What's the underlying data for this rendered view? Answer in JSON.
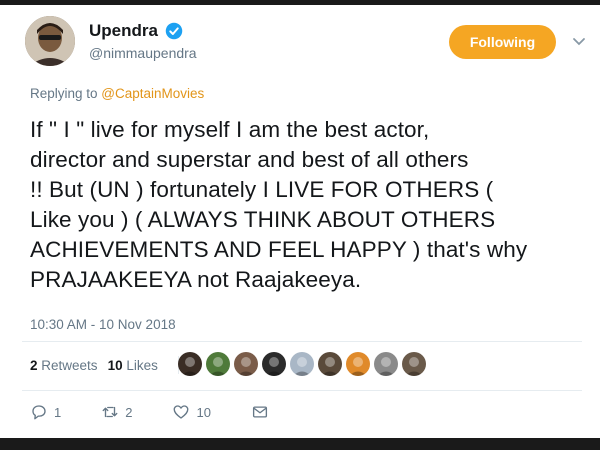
{
  "author": {
    "name": "Upendra",
    "handle": "@nimmaupendra",
    "avatar_icon": "profile-photo"
  },
  "follow_button": {
    "label": "Following",
    "color": "#f5a623"
  },
  "reply": {
    "prefix": "Replying to ",
    "mention": "@CaptainMovies",
    "mention_color": "#e29519"
  },
  "tweet": {
    "text": "If  \" I \"  live for myself I am the best actor,\ndirector and superstar and best of all others\n!!   But (UN ) fortunately I LIVE FOR OTHERS (\nLike you )  ( ALWAYS THINK ABOUT OTHERS\nACHIEVEMENTS AND FEEL HAPPY ) that's why\nPRAJAAKEEYA not Raajakeeya.",
    "timestamp": "10:30 AM - 10 Nov 2018"
  },
  "stats": {
    "retweets_count": "2",
    "retweets_label": "Retweets",
    "likes_count": "10",
    "likes_label": "Likes",
    "liker_avatars": [
      "#3a2d25",
      "#4f7a3a",
      "#7a5c49",
      "#2b2b2b",
      "#a9b7c6",
      "#5a4a3a",
      "#e08a2a",
      "#8a8a8a",
      "#6a5a4a"
    ]
  },
  "actions": {
    "reply_count": "1",
    "retweet_count": "2",
    "like_count": "10",
    "message_icon": "envelope-icon"
  }
}
